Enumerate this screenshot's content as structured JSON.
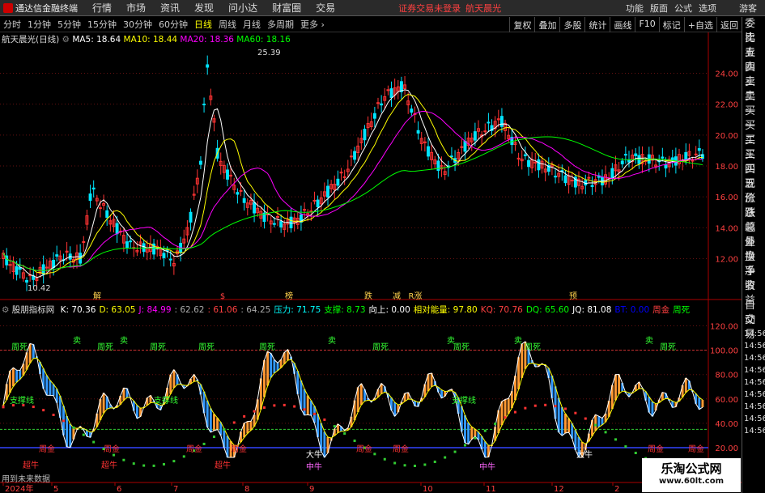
{
  "topbar": {
    "app_title": "通达信金融终端",
    "menus": [
      "行情",
      "市场",
      "资讯",
      "发现",
      "问小达",
      "财富圈",
      "交易"
    ],
    "status_text": "证券交易未登录",
    "stock_name": "航天晨光",
    "right_menus": [
      "功能",
      "版面",
      "公式",
      "选项"
    ],
    "guest": "游客"
  },
  "period_tabs": [
    "分时",
    "1分钟",
    "5分钟",
    "15分钟",
    "30分钟",
    "60分钟",
    "日线",
    "周线",
    "月线",
    "多周期",
    "更多"
  ],
  "active_tab": "日线",
  "toolbar_buttons": [
    "复权",
    "叠加",
    "多股",
    "统计",
    "画线",
    "F10",
    "标记",
    "+自选",
    "返回"
  ],
  "main_chart": {
    "title": "航天晨光(日线)",
    "ma": [
      {
        "label": "MA5: 18.64",
        "color": "#ffffff"
      },
      {
        "label": "MA10: 18.44",
        "color": "#ffff00"
      },
      {
        "label": "MA20: 18.36",
        "color": "#ff00ff"
      },
      {
        "label": "MA60: 18.16",
        "color": "#00ff00"
      }
    ],
    "high_label": "25.39",
    "low_label": "10.42",
    "yticks": [
      "24.00",
      "22.00",
      "20.00",
      "18.00",
      "16.00",
      "14.00",
      "12.00"
    ],
    "markers": [
      "解",
      "$",
      "榜",
      "跌",
      "减",
      "R涨",
      "预"
    ]
  },
  "indicator": {
    "name": "股朋指标网",
    "values": [
      {
        "t": "K: 70.36",
        "c": "#ffffff"
      },
      {
        "t": "D: 63.05",
        "c": "#ffff00"
      },
      {
        "t": "J: 84.99",
        "c": "#ff00ff"
      },
      {
        "t": ": 62.62",
        "c": "#aaaaaa"
      },
      {
        "t": ": 61.06",
        "c": "#ff4040"
      },
      {
        "t": ": 64.25",
        "c": "#aaaaaa"
      },
      {
        "t": "压力: 71.75",
        "c": "#00ffff"
      },
      {
        "t": "支撑: 8.73",
        "c": "#00ff00"
      },
      {
        "t": "向上: 0.00",
        "c": "#ffffff"
      },
      {
        "t": "相对能量: 97.80",
        "c": "#ffff00"
      },
      {
        "t": "KQ: 70.76",
        "c": "#ff4040"
      },
      {
        "t": "DQ: 65.60",
        "c": "#00ff00"
      },
      {
        "t": "JQ: 81.08",
        "c": "#ffffff"
      },
      {
        "t": "BT: 0.00",
        "c": "#0000ff"
      },
      {
        "t": "周金",
        "c": "#ff4040"
      },
      {
        "t": "周死",
        "c": "#00ff00"
      }
    ],
    "yticks": [
      "120.00",
      "100.00",
      "80.00",
      "60.00",
      "40.00",
      "20.00"
    ],
    "labels": {
      "dead": "周死",
      "sell": "卖",
      "gold": "周金",
      "super_bull": "超牛",
      "mid_bull": "中牛",
      "big_bull": "大牛",
      "trend_line": "支撑线"
    }
  },
  "xaxis": [
    "2024年",
    "5",
    "6",
    "7",
    "8",
    "9",
    "10",
    "11",
    "12",
    "2",
    "3"
  ],
  "side_panel": [
    "委比",
    "卖五",
    "卖四",
    "卖三",
    "卖二",
    "卖一",
    "买一",
    "买二",
    "买三",
    "买四",
    "买五",
    "现价",
    "涨跌",
    "涨幅",
    "总量",
    "外盘",
    "换手",
    "净资",
    "收益",
    "",
    "自动",
    "交易",
    "14:56",
    "14:56",
    "14:56",
    "14:56",
    "14:56",
    "14:56",
    "14:56",
    "14:56",
    "14:56"
  ],
  "watermark": {
    "title": "乐淘公式网",
    "url": "www.60lt.com"
  },
  "data_note": "用到未来数据",
  "colors": {
    "up": "#ff3333",
    "down": "#00e5ff",
    "ma5": "#ffffff",
    "ma10": "#ffff00",
    "ma20": "#ff00ff",
    "ma60": "#00ff00",
    "grid": "#661111"
  }
}
